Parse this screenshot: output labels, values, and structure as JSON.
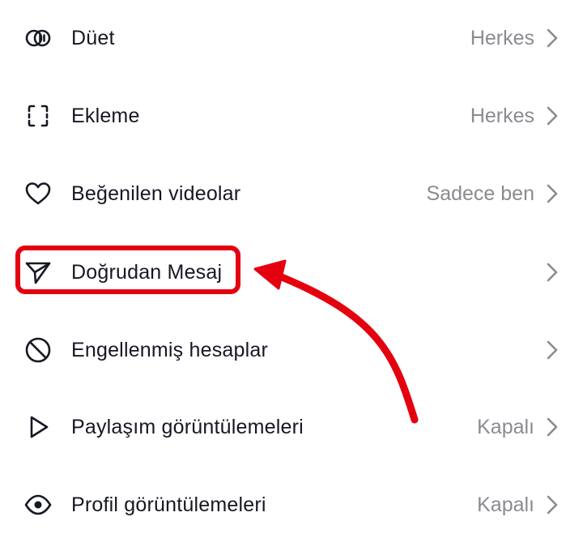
{
  "settings": {
    "items": [
      {
        "label": "Düet",
        "value": "Herkes",
        "icon": "duet-icon"
      },
      {
        "label": "Ekleme",
        "value": "Herkes",
        "icon": "stitch-icon"
      },
      {
        "label": "Beğenilen videolar",
        "value": "Sadece ben",
        "icon": "heart-icon"
      },
      {
        "label": "Doğrudan Mesaj",
        "value": "",
        "icon": "send-icon"
      },
      {
        "label": "Engellenmiş hesaplar",
        "value": "",
        "icon": "block-icon"
      },
      {
        "label": "Paylaşım görüntülemeleri",
        "value": "Kapalı",
        "icon": "play-icon"
      },
      {
        "label": "Profil görüntülemeleri",
        "value": "Kapalı",
        "icon": "eye-icon"
      }
    ]
  },
  "colors": {
    "text": "#161823",
    "secondary_text": "#8a8b91",
    "icon": "#161823",
    "annotation": "#e4000f"
  }
}
